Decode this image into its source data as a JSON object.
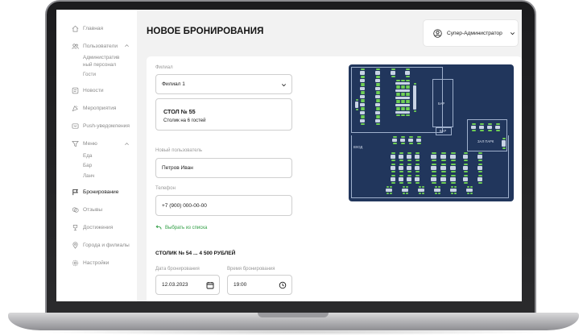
{
  "sidebar": {
    "items": [
      {
        "label": "Главная",
        "icon": "home-icon"
      },
      {
        "label": "Пользователи",
        "icon": "users-icon",
        "sub": [
          "Административный персонал",
          "Гости"
        ]
      },
      {
        "label": "Новости",
        "icon": "news-icon"
      },
      {
        "label": "Мероприятия",
        "icon": "events-icon"
      },
      {
        "label": "Push-уведомления",
        "icon": "push-icon"
      },
      {
        "label": "Меню",
        "icon": "menu-filter-icon",
        "sub": [
          "Еда",
          "Бар",
          "Ланч"
        ]
      },
      {
        "label": "Бронирование",
        "icon": "flag-icon",
        "active": true
      },
      {
        "label": "Отзывы",
        "icon": "reviews-icon"
      },
      {
        "label": "Достижения",
        "icon": "trophy-icon"
      },
      {
        "label": "Города и филиалы",
        "icon": "location-icon"
      },
      {
        "label": "Настройки",
        "icon": "gear-icon"
      }
    ],
    "users_sub_line1": "Административ",
    "users_sub_line2": "ный персонал",
    "users_sub_guests": "Гости",
    "menu_sub_food": "Еда",
    "menu_sub_bar": "Бар",
    "menu_sub_lunch": "Ланч"
  },
  "header": {
    "title": "НОВОЕ БРОНИРОВАНИЯ",
    "user_role": "Супер-Администратор"
  },
  "form": {
    "branch_label": "Филиал",
    "branch_value": "Филиал 1",
    "table_title": "СТОЛ № 55",
    "table_desc": "Столик на 6 гостей",
    "new_user_label": "Новый пользователь",
    "new_user_value": "Петров Иван",
    "phone_label": "Телефон",
    "phone_value": "+7 (900) 000-00-00",
    "pick_from_list": "Выбрать из списка",
    "summary": "СТОЛИК № 54 ... 4 500 РУБЛЕЙ",
    "date_label": "Дата бронирования",
    "date_value": "12.03.2023",
    "time_label": "Время бронирования",
    "time_value": "19:00"
  },
  "floor_plan": {
    "bar_label": "БАР",
    "bar_label_small": "БАР",
    "zone_label": "ЗАЛ ПАРК",
    "entrance_label": "ВХОД"
  },
  "colors": {
    "accent": "#2f9e44",
    "seat": "#6fcf55",
    "floor": "#21365c"
  }
}
